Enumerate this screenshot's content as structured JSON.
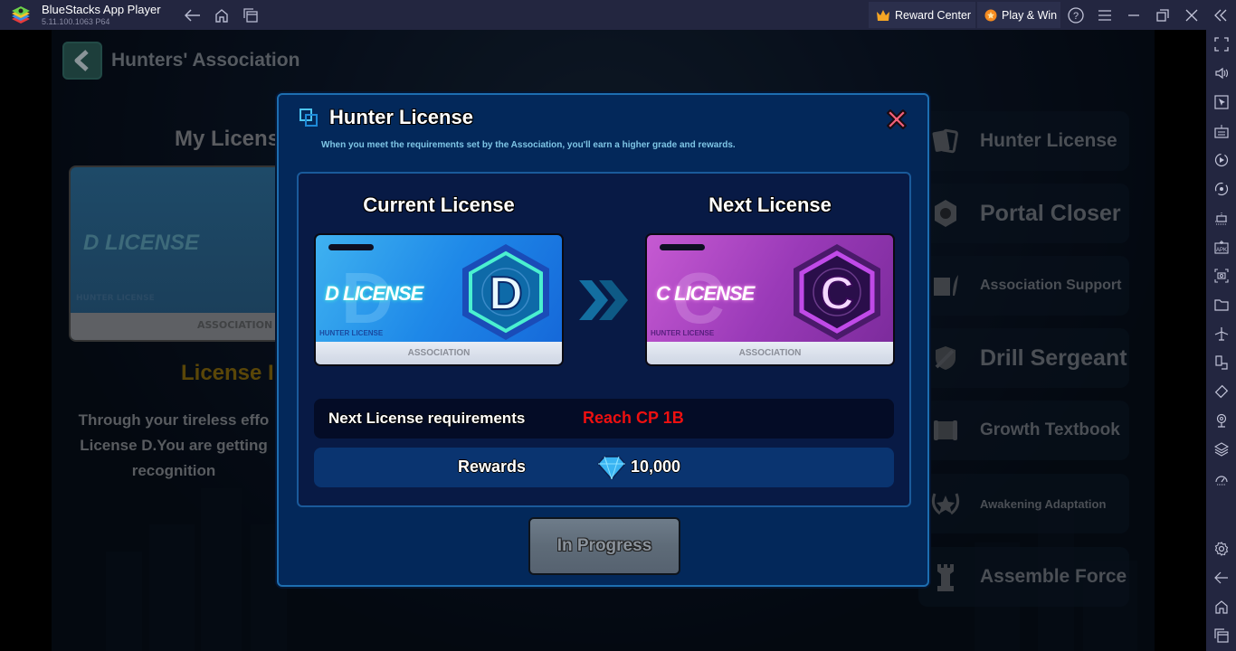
{
  "titlebar": {
    "app_name": "BlueStacks App Player",
    "version": "5.11.100.1063  P64",
    "reward_center": "Reward Center",
    "play_win": "Play & Win"
  },
  "game": {
    "page_heading": "Hunters' Association",
    "my_license_title": "My Licens",
    "bg_card": {
      "name": "D LICENSE",
      "hunter_label": "HUNTER LICENSE",
      "association": "ASSOCIATION"
    },
    "license_label": "License I",
    "license_desc": [
      "Through your tireless effo",
      "License D.You are getting",
      "recognition"
    ],
    "menu": [
      {
        "label": "Hunter License",
        "icon": "cards-icon"
      },
      {
        "label": "Portal Closer",
        "icon": "portal-icon"
      },
      {
        "label": "Association Support",
        "icon": "book-quill-icon"
      },
      {
        "label": "Drill Sergeant",
        "icon": "shield-sword-icon"
      },
      {
        "label": "Growth Textbook",
        "icon": "scroll-icon"
      },
      {
        "label": "Awakening Adaptation",
        "icon": "laurel-star-icon"
      },
      {
        "label": "Assemble Force",
        "icon": "rook-icon"
      }
    ]
  },
  "dialog": {
    "title": "Hunter License",
    "subtitle": "When you meet the requirements set by the Association, you'll earn a higher grade and rewards.",
    "current": {
      "title": "Current License",
      "card_name": "D LICENSE",
      "letter": "D",
      "hunter_label": "HUNTER LICENSE",
      "association": "ASSOCIATION"
    },
    "next": {
      "title": "Next License",
      "card_name": "C LICENSE",
      "letter": "C",
      "hunter_label": "HUNTER LICENSE",
      "association": "ASSOCIATION"
    },
    "requirements_label": "Next License requirements",
    "requirements_value": "Reach CP 1B",
    "rewards_label": "Rewards",
    "rewards_value": "10,000",
    "button_label": "In Progress",
    "colors": {
      "requirement": "#ee1010",
      "close": "#f0607a",
      "panel": "#03285a"
    }
  },
  "sidebar": {
    "icons": [
      "fullscreen-icon",
      "volume-icon",
      "pointer-icon",
      "keyboard-icon",
      "macro-play-icon",
      "sync-icon",
      "rotate-shake-icon",
      "apk-install-icon",
      "screenshot-icon",
      "folder-icon",
      "airplane-icon",
      "multi-instance-icon",
      "eco-mode-icon",
      "location-icon",
      "layers-icon",
      "performance-icon",
      "settings-icon",
      "back-icon",
      "home-icon",
      "recent-apps-icon"
    ]
  }
}
